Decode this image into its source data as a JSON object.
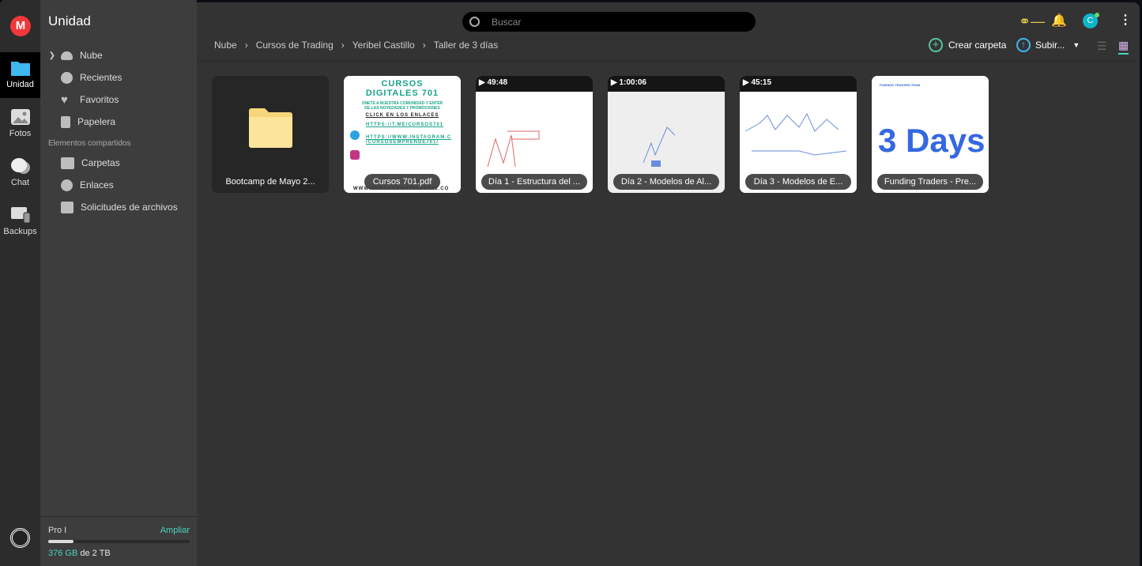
{
  "rail": {
    "items": [
      {
        "label": "Unidad",
        "icon": "folder-icon",
        "active": true
      },
      {
        "label": "Fotos",
        "icon": "photos-icon"
      },
      {
        "label": "Chat",
        "icon": "chat-icon"
      },
      {
        "label": "Backups",
        "icon": "backups-icon"
      }
    ]
  },
  "sidebar": {
    "title": "Unidad",
    "items": [
      {
        "label": "Nube",
        "icon": "cloud-icon"
      },
      {
        "label": "Recientes",
        "icon": "clock-icon"
      },
      {
        "label": "Favoritos",
        "icon": "heart-icon"
      },
      {
        "label": "Papelera",
        "icon": "trash-icon"
      }
    ],
    "shared_title": "Elementos compartidos",
    "shared": [
      {
        "label": "Carpetas",
        "icon": "shared-folder-icon"
      },
      {
        "label": "Enlaces",
        "icon": "link-icon"
      },
      {
        "label": "Solicitudes de archivos",
        "icon": "file-request-icon"
      }
    ],
    "plan": "Pro I",
    "upgrade": "Ampliar",
    "used": "376 GB",
    "of": "de 2 TB",
    "usage_fraction": 0.18
  },
  "header": {
    "search_placeholder": "Buscar",
    "avatar_initial": "C",
    "breadcrumb": [
      "Nube",
      "Cursos de Trading",
      "Yeribel Castillo",
      "Taller de 3 días"
    ],
    "create_folder": "Crear carpeta",
    "upload": "Subir..."
  },
  "colors": {
    "accent": "#4fd1c5",
    "mega_red": "#f0373a",
    "key": "#e6c84a"
  },
  "files": [
    {
      "name": "Bootcamp de Mayo 2...",
      "type": "folder"
    },
    {
      "name": "Cursos 701.pdf",
      "type": "pdf",
      "thumb": {
        "title1": "CURSOS",
        "title2": "DIGITALES 701",
        "line1": "ÚNETE A NUESTRA COMUNIDAD Y ENTÉR",
        "line2": "DE LAS NOVEDADES Y PROMOCIONES",
        "cta": "CLICK EN LOS ENLACES",
        "link1": "HTTPS://T.ME/CURSOS701",
        "link2": "HTTPS://WWW.INSTAGRAM.C /CURSOSEMPRENDE701/",
        "footer": "WWW.CURSOSDIGITALES701.CO"
      }
    },
    {
      "name": "Día 1 - Estructura del ...",
      "type": "video",
      "duration": "49:48"
    },
    {
      "name": "Día 2 - Modelos de Al...",
      "type": "video",
      "duration": "1:00:06"
    },
    {
      "name": "Día 3 - Modelos de E...",
      "type": "video",
      "duration": "45:15"
    },
    {
      "name": "Funding Traders - Pre...",
      "type": "image",
      "thumb": {
        "brand": "FUNDING TRADERS TEAM",
        "big": "3 Days"
      }
    }
  ]
}
